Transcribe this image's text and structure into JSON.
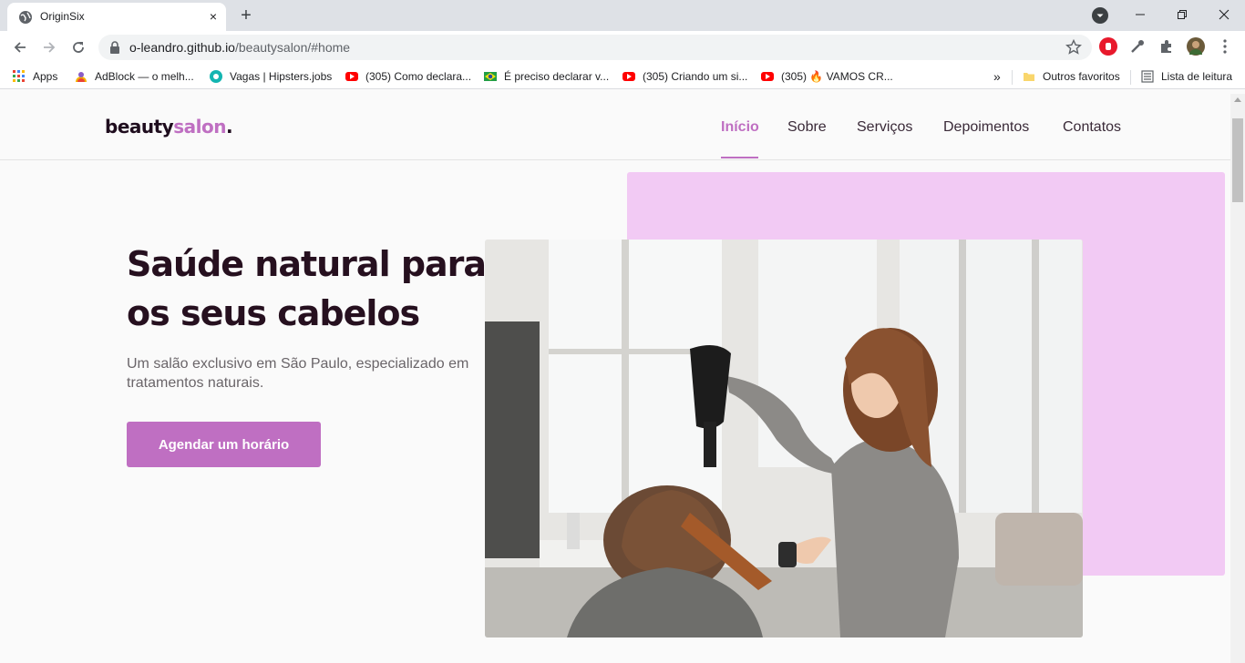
{
  "browser": {
    "tab_title": "OriginSix",
    "tab_close": "×",
    "new_tab": "+",
    "url_host": "o-leandro.github.io",
    "url_path": "/beautysalon/#home",
    "bookmarks": [
      {
        "label": "Apps",
        "icon": "apps-grid-icon"
      },
      {
        "label": "AdBlock — o melh...",
        "icon": "adblock-icon"
      },
      {
        "label": "Vagas | Hipsters.jobs",
        "icon": "hipsters-icon"
      },
      {
        "label": "(305) Como declara...",
        "icon": "youtube-icon"
      },
      {
        "label": "É preciso declarar v...",
        "icon": "brazil-flag-icon"
      },
      {
        "label": "(305) Criando um si...",
        "icon": "youtube-icon"
      },
      {
        "label": "(305) 🔥 VAMOS CR...",
        "icon": "youtube-icon"
      }
    ],
    "bookmarks_overflow": "»",
    "other_bookmarks": "Outros favoritos",
    "reading_list": "Lista de leitura"
  },
  "site": {
    "logo_main": "beauty",
    "logo_accent": "salon",
    "logo_dot": ".",
    "nav": [
      {
        "label": "Início",
        "active": true
      },
      {
        "label": "Sobre",
        "active": false
      },
      {
        "label": "Serviços",
        "active": false
      },
      {
        "label": "Depoimentos",
        "active": false
      },
      {
        "label": "Contatos",
        "active": false
      }
    ],
    "hero": {
      "title": "Saúde natural para os seus cabelos",
      "text": "Um salão exclusivo em São Paulo, especializado em tratamentos naturais.",
      "cta": "Agendar um horário"
    }
  },
  "colors": {
    "accent": "#bf6fc2",
    "accent_light": "#f2caf4",
    "heading": "#26101f"
  }
}
